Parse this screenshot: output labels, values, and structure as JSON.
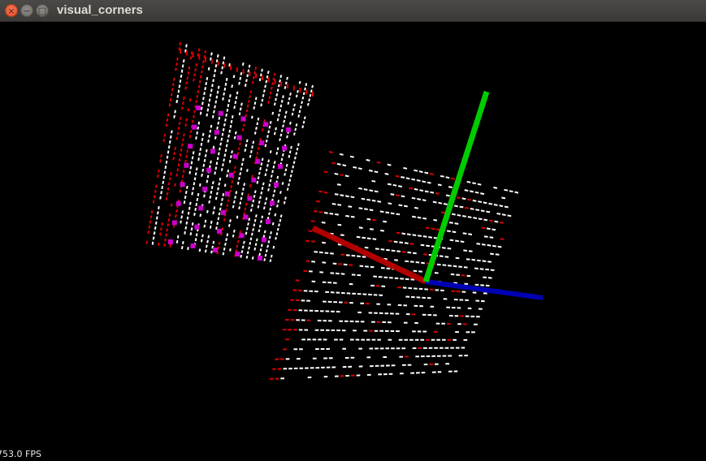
{
  "window": {
    "title": "visual_corners",
    "buttons": {
      "close": "close",
      "minimize": "minimize",
      "maximize": "maximize"
    }
  },
  "viewport": {
    "background": "#000000",
    "fps_text": "753.0 FPS",
    "colors": {
      "x_axis": "#b00000",
      "y_axis": "#00cc00",
      "z_axis": "#0000b4",
      "point_white": "#ffffff",
      "point_red": "#dd0000",
      "corner_marker": "#cc00cc"
    },
    "icons": {
      "close": "close-icon",
      "minimize": "minimize-icon",
      "maximize": "maximize-icon"
    }
  }
}
